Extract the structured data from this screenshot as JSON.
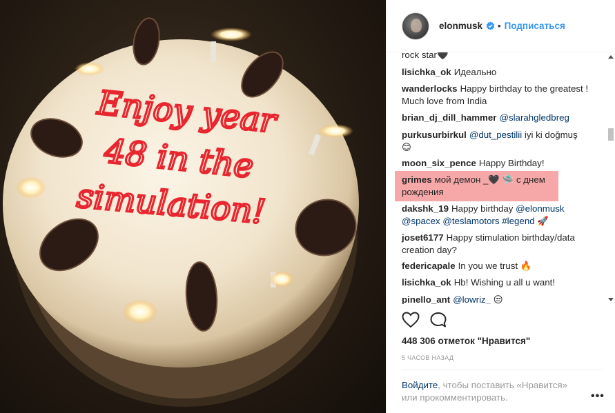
{
  "post": {
    "image_caption": "Enjoy year 48 in the simulation!",
    "image_lines": [
      "Enjoy year",
      "48 in the",
      "simulation!"
    ]
  },
  "header": {
    "username": "elonmusk",
    "separator": "•",
    "follow_label": "Подписаться"
  },
  "comments": [
    {
      "user": "",
      "text": "rock star",
      "emoji": "black-heart"
    },
    {
      "user": "lisichka_ok",
      "text": "Идеально"
    },
    {
      "user": "wanderlocks",
      "text": "Happy birthday to the greatest ! Much love from India"
    },
    {
      "user": "brian_dj_dill_hammer",
      "text": "@slarahgledbreg"
    },
    {
      "user": "purkusurbirkul",
      "mention": "@dut_pestilii",
      "text": "iyi ki doğmuş",
      "emoji": "smiley"
    },
    {
      "user": "moon_six_pence",
      "text": "Happy Birthday!"
    },
    {
      "user": "grimes",
      "text_a": "мой демон _",
      "text_b": "с днем рождения",
      "emoji": "black-heart, flying-saucer"
    },
    {
      "user": "dakshk_19",
      "text": "Happy birthday",
      "mention1": "@elonmusk",
      "mention2": "@spacex",
      "mention3": "@teslamotors",
      "mention4": "#legend",
      "emoji": "rocket"
    },
    {
      "user": "joset6177",
      "text": "Happy stimulation birthday/data creation day?"
    },
    {
      "user": "federicapale",
      "text": "In you we trust",
      "emoji": "fire"
    },
    {
      "user": "lisichka_ok",
      "text": "Hb! Wishing u all u want!"
    },
    {
      "user": "pinello_ant",
      "mention": "@lowriz_",
      "emoji": "unamused"
    }
  ],
  "likes_text": "448 306 отметок \"Нравится\"",
  "time_text": "5 часов назад",
  "login": {
    "link": "Войдите",
    "rest": ", чтобы поставить «Нравится» или прокомментировать."
  },
  "more_label": "•••",
  "colors": {
    "link": "#3897f0",
    "mention": "#003569",
    "highlight": "#f6a7a8",
    "muted": "#999999",
    "icing": "#e8262f"
  }
}
